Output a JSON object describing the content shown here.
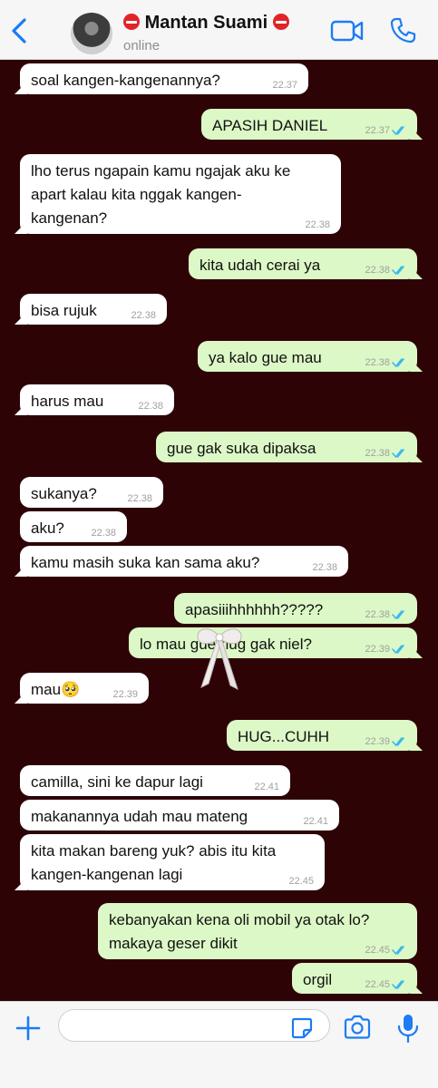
{
  "header": {
    "contact_name": "Mantan Suami",
    "status": "online",
    "accent_color": "#1b7cf5",
    "icons": [
      "chevron-left-icon",
      "no-entry-emoji-icon",
      "video-camera-icon",
      "phone-icon"
    ]
  },
  "messages": [
    {
      "dir": "in",
      "text": "soal kangen-kangenannya?",
      "time": "22.37"
    },
    {
      "dir": "out",
      "text": "APASIH DANIEL",
      "time": "22.37",
      "read": true
    },
    {
      "dir": "in",
      "text": "lho terus ngapain kamu ngajak aku ke\napart kalau kita nggak kangen-\nkangenan?",
      "time": "22.38"
    },
    {
      "dir": "out",
      "text": "kita udah cerai ya",
      "time": "22.38",
      "read": true
    },
    {
      "dir": "in",
      "text": "bisa rujuk",
      "time": "22.38"
    },
    {
      "dir": "out",
      "text": "ya kalo gue mau",
      "time": "22.38",
      "read": true
    },
    {
      "dir": "in",
      "text": "harus mau",
      "time": "22.38"
    },
    {
      "dir": "out",
      "text": "gue gak suka dipaksa",
      "time": "22.38",
      "read": true
    },
    {
      "dir": "in",
      "text": "sukanya?",
      "time": "22.38"
    },
    {
      "dir": "in",
      "text": "aku?",
      "time": "22.38"
    },
    {
      "dir": "in",
      "text": "kamu masih suka kan sama aku?",
      "time": "22.38"
    },
    {
      "dir": "out",
      "text": "apasiiihhhhhh?????",
      "time": "22.38",
      "read": true
    },
    {
      "dir": "out",
      "text": "lo mau gue hug gak niel?",
      "time": "22.39",
      "read": true
    },
    {
      "dir": "in",
      "text": "mau🥺",
      "time": "22.39"
    },
    {
      "dir": "out",
      "text": "HUG...CUHH",
      "time": "22.39",
      "read": true
    },
    {
      "dir": "in",
      "text": "camilla, sini ke dapur lagi",
      "time": "22.41"
    },
    {
      "dir": "in",
      "text": "makanannya udah mau mateng",
      "time": "22.41"
    },
    {
      "dir": "in",
      "text": "kita makan bareng yuk? abis itu kita\nkangen-kangenan lagi",
      "time": "22.45"
    },
    {
      "dir": "out",
      "text": "kebanyakan kena oli mobil ya otak lo?\nmakaya geser dikit",
      "time": "22.45",
      "read": true
    },
    {
      "dir": "out",
      "text": "orgil",
      "time": "22.45",
      "read": true
    }
  ],
  "input": {
    "placeholder": "",
    "value": ""
  },
  "colors": {
    "chat_background": "#2e0306",
    "incoming_bubble": "#ffffff",
    "outgoing_bubble": "#dcf8c6",
    "read_ticks": "#34b7f1"
  }
}
